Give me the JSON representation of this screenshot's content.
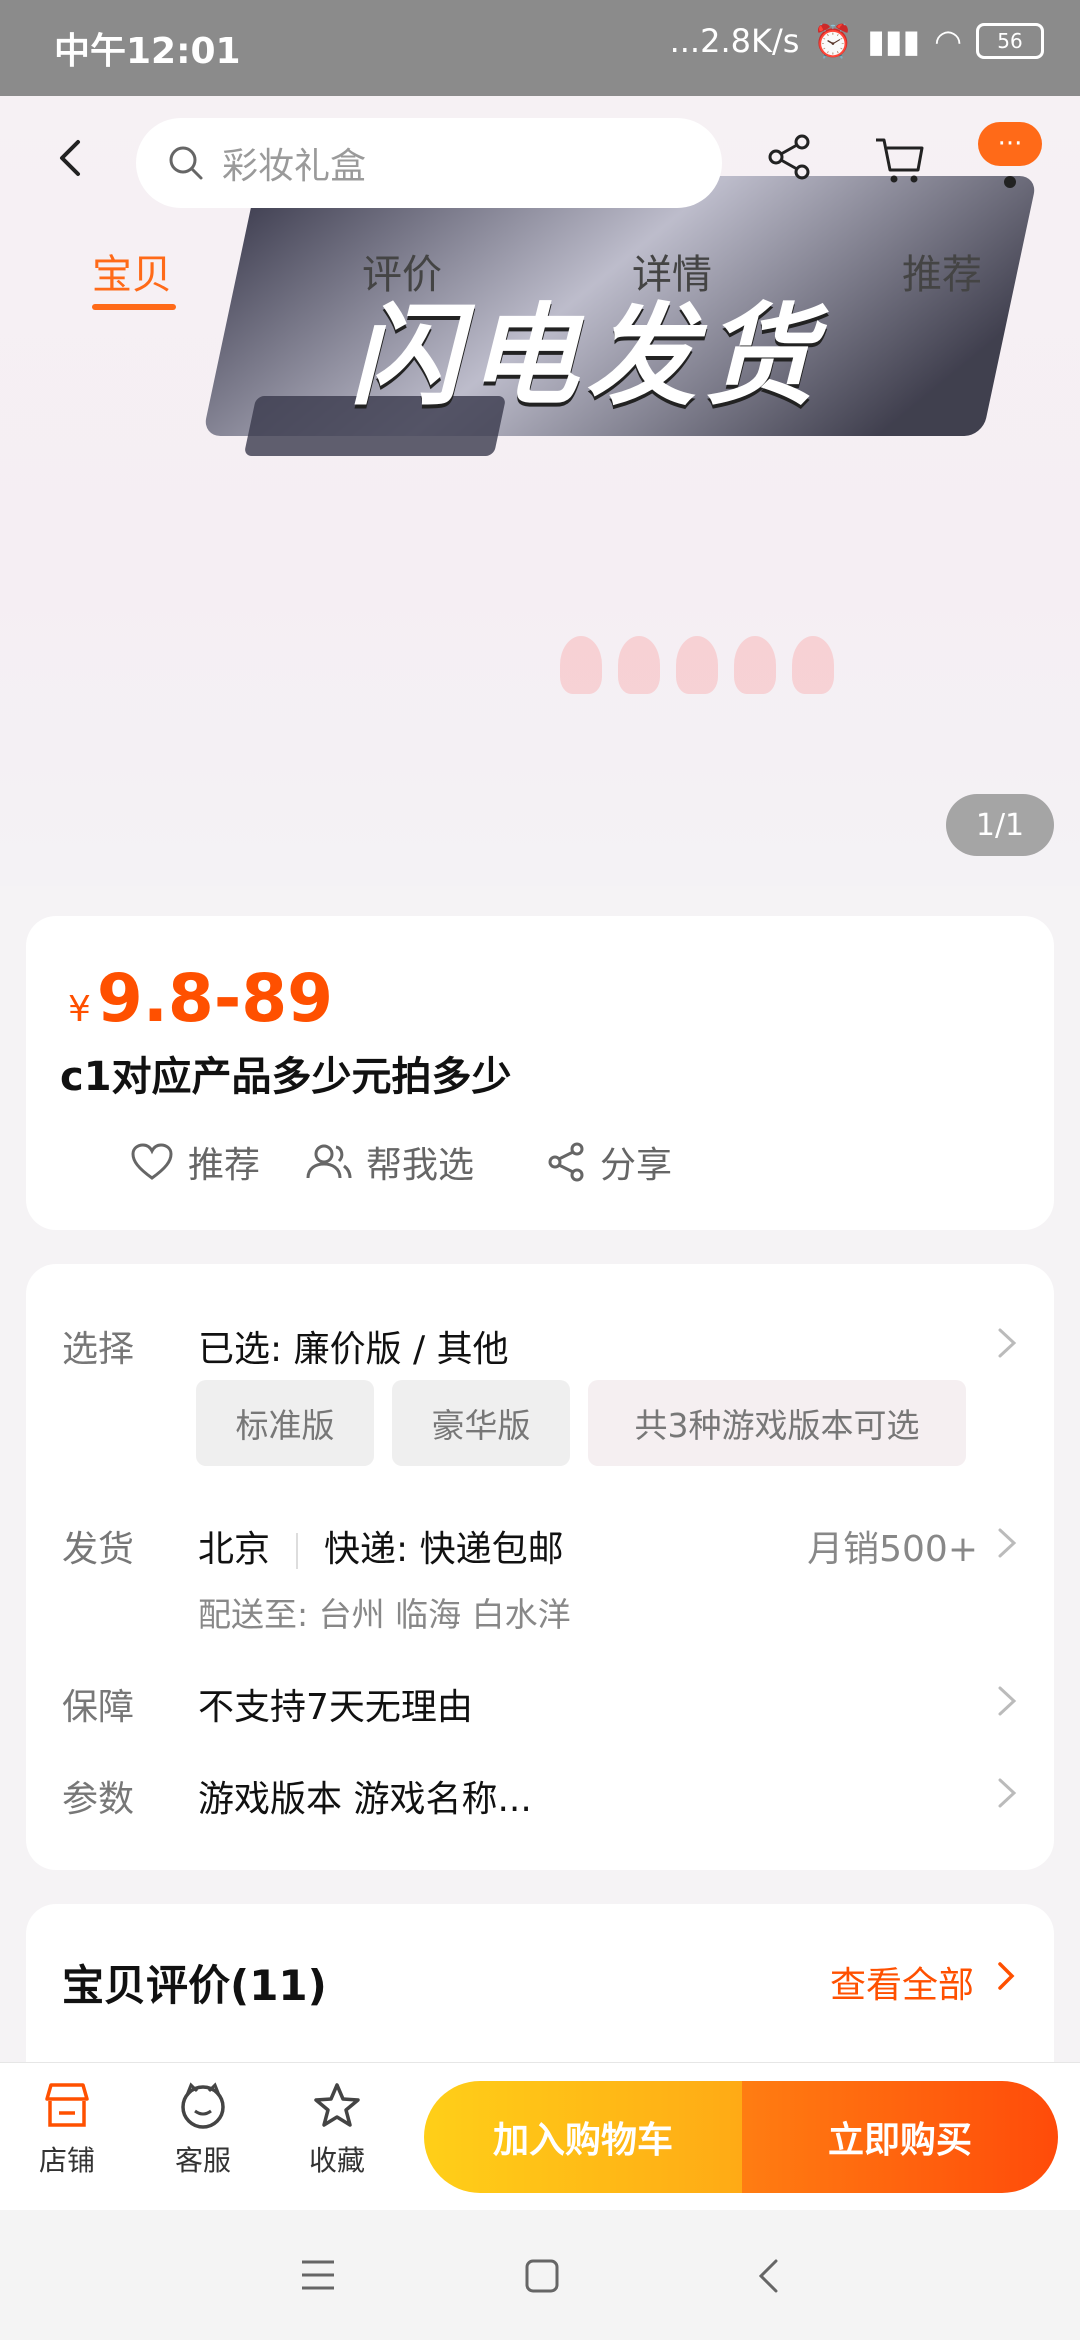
{
  "status_bar": {
    "time": "中午12:01",
    "network_speed": "...2.8K/s",
    "battery": "56"
  },
  "header": {
    "search_placeholder": "彩妆礼盒"
  },
  "hero": {
    "overlay_text": "闪电发货",
    "pager": "1/1"
  },
  "tabs": [
    "宝贝",
    "评价",
    "详情",
    "推荐"
  ],
  "product": {
    "currency": "¥",
    "price": "9.8-89",
    "title": "c1对应产品多少元拍多少",
    "actions": {
      "recommend": "推荐",
      "help_choose": "帮我选",
      "share": "分享"
    }
  },
  "details": {
    "select_label": "选择",
    "select_value": "已选: 廉价版 / 其他",
    "chips": [
      "标准版",
      "豪华版",
      "共3种游戏版本可选"
    ],
    "ship_label": "发货",
    "ship_city": "北京",
    "ship_method": "快递: 快递包邮",
    "monthly_sales": "月销500+",
    "deliver_to": "配送至: 台州 临海 白水洋",
    "guarantee_label": "保障",
    "guarantee_value": "不支持7天无理由",
    "params_label": "参数",
    "params_value": "游戏版本 游戏名称..."
  },
  "reviews": {
    "title": "宝贝评价(11)",
    "view_all": "查看全部"
  },
  "bottom_bar": {
    "shop": "店铺",
    "service": "客服",
    "favorite": "收藏",
    "add_to_cart": "加入购物车",
    "buy_now": "立即购买"
  },
  "colors": {
    "accent": "#ff5000",
    "cart_button": "#ffbe18",
    "buy_button": "#ff6010"
  }
}
